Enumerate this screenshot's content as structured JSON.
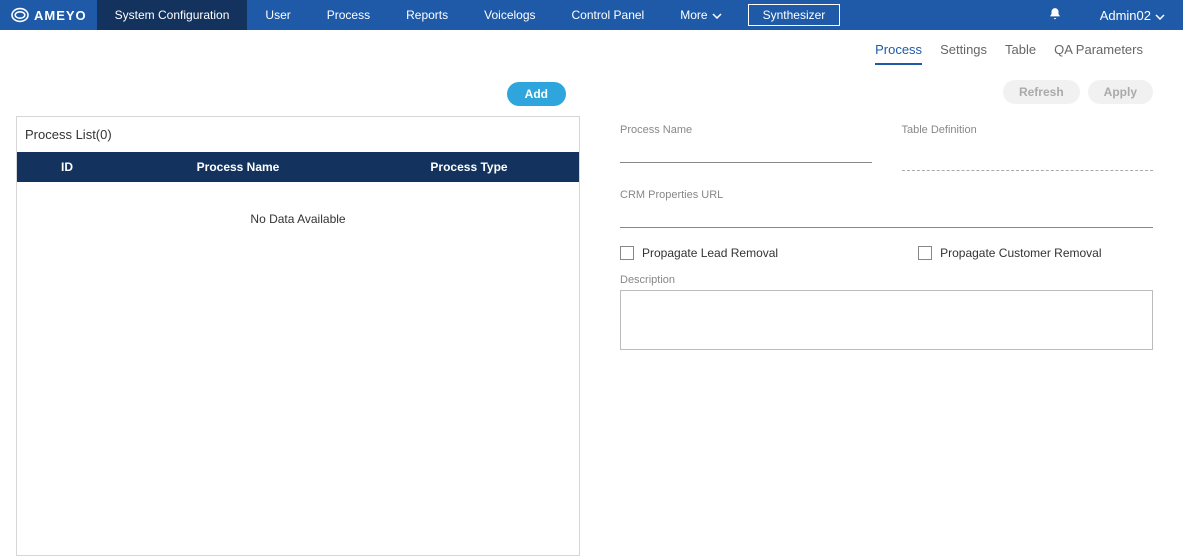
{
  "brand": "AMEYO",
  "nav": {
    "items": [
      {
        "label": "System Configuration",
        "active": true
      },
      {
        "label": "User"
      },
      {
        "label": "Process"
      },
      {
        "label": "Reports"
      },
      {
        "label": "Voicelogs"
      },
      {
        "label": "Control Panel"
      },
      {
        "label": "More",
        "dropdown": true
      }
    ],
    "button": "Synthesizer"
  },
  "user": {
    "name": "Admin02"
  },
  "subtabs": [
    {
      "label": "Process",
      "active": true
    },
    {
      "label": "Settings"
    },
    {
      "label": "Table"
    },
    {
      "label": "QA Parameters"
    }
  ],
  "actions": {
    "add": "Add",
    "refresh": "Refresh",
    "apply": "Apply"
  },
  "panel": {
    "title": "Process List(0)",
    "cols": [
      "ID",
      "Process Name",
      "Process Type"
    ],
    "no_data": "No Data Available"
  },
  "form": {
    "process_name_label": "Process Name",
    "table_definition_label": "Table Definition",
    "crm_label": "CRM Properties URL",
    "lead_removal": "Propagate Lead Removal",
    "customer_removal": "Propagate Customer Removal",
    "description_label": "Description"
  }
}
